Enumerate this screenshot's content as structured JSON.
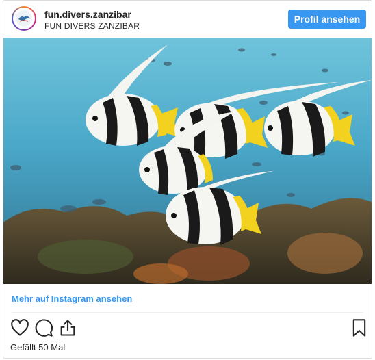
{
  "post": {
    "username": "fun.divers.zanzibar",
    "subtitle": "FUN DIVERS ZANZIBAR",
    "profile_button": "Profil ansehen",
    "more_link": "Mehr auf Instagram ansehen",
    "likes": "Gefällt 50 Mal"
  },
  "icons": {
    "like": "heart-icon",
    "comment": "comment-icon",
    "share": "share-icon",
    "save": "bookmark-icon"
  },
  "colors": {
    "accent": "#3897f0",
    "text": "#262626",
    "border": "#dbdbdb"
  }
}
